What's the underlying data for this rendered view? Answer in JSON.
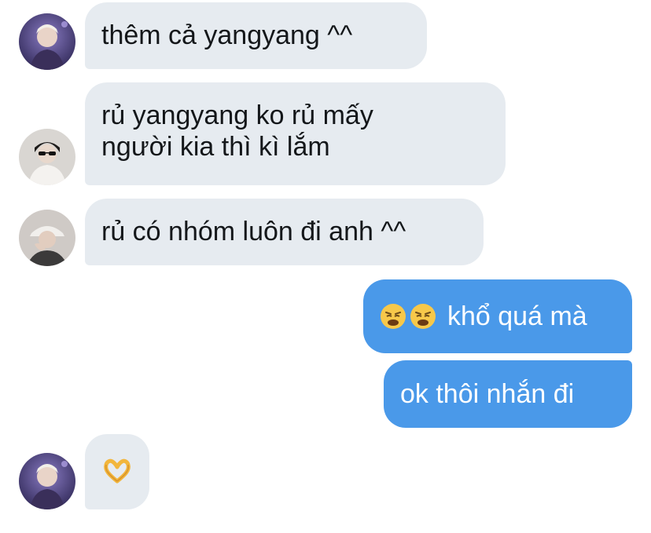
{
  "conversation": {
    "messages": [
      {
        "direction": "incoming",
        "avatar": "avatar-purple-portrait",
        "lines": [
          "thêm cả yangyang ^^"
        ]
      },
      {
        "direction": "incoming",
        "avatar": "avatar-sunglasses-portrait",
        "lines": [
          "rủ yangyang ko rủ mấy",
          "người kia thì kì lắm"
        ]
      },
      {
        "direction": "incoming",
        "avatar": "avatar-cap-portrait",
        "lines": [
          "rủ có nhóm luôn đi anh ^^"
        ]
      },
      {
        "direction": "outgoing",
        "emoji": [
          "weary-face-emoji",
          "weary-face-emoji"
        ],
        "lines": [
          "khổ quá mà"
        ]
      },
      {
        "direction": "outgoing",
        "lines": [
          "ok thôi nhắn đi"
        ]
      },
      {
        "direction": "incoming",
        "avatar": "avatar-purple-portrait",
        "emoji": [
          "heart-hands-emoji"
        ],
        "lines": [
          ""
        ]
      }
    ]
  },
  "colors": {
    "incoming_bubble": "#e6ebf0",
    "outgoing_bubble": "#4a99e9",
    "incoming_text": "#14171a",
    "outgoing_text": "#ffffff"
  }
}
